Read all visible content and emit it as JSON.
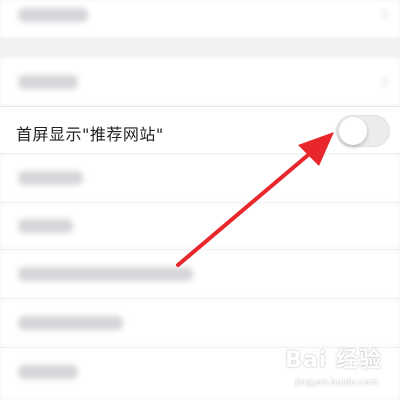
{
  "setting": {
    "label": "首屏显示\"推荐网站\"",
    "toggle_state": "off"
  },
  "watermark": {
    "logo": "Bai 经验",
    "url": "jingyan.baidu.com"
  },
  "colors": {
    "arrow": "#e8262b",
    "toggle_track": "#ececee",
    "background": "#f4f4f6"
  }
}
